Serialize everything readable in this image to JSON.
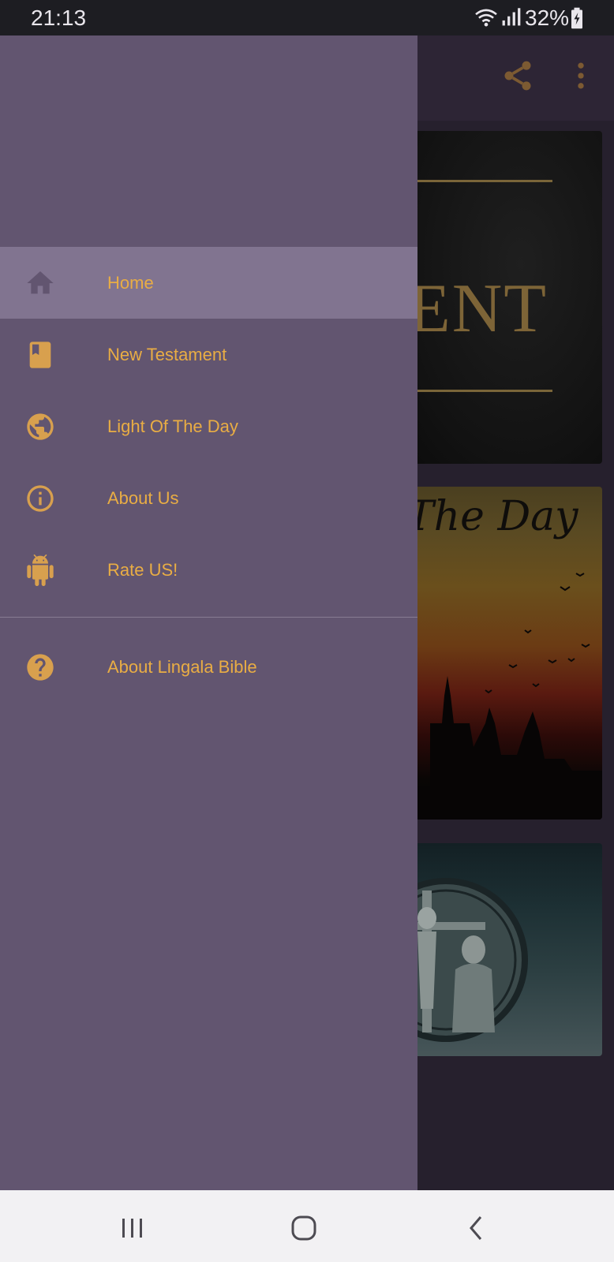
{
  "status_bar": {
    "time": "21:13",
    "battery_percent": "32%",
    "icons": [
      "wifi-icon",
      "signal-icon",
      "battery-charging-icon"
    ]
  },
  "toolbar": {
    "icons": [
      "share-icon",
      "more-vert-icon"
    ],
    "accent_color": "#b27a36"
  },
  "background_cards": {
    "new_testament_text": "ENT",
    "light_of_day_text": "The Day"
  },
  "drawer": {
    "background_color": "#625570",
    "selected_color": "#817490",
    "label_color": "#e9ad44",
    "menu_items": [
      {
        "label": "Home",
        "icon": "home-icon",
        "selected": true
      },
      {
        "label": "New Testament",
        "icon": "book-icon",
        "selected": false
      },
      {
        "label": "Light Of The Day",
        "icon": "globe-icon",
        "selected": false
      },
      {
        "label": "About Us",
        "icon": "info-icon",
        "selected": false
      },
      {
        "label": "Rate US!",
        "icon": "android-icon",
        "selected": false
      }
    ],
    "secondary_items": [
      {
        "label": "About Lingala Bible",
        "icon": "help-icon",
        "selected": false
      }
    ]
  },
  "nav_bar": {
    "buttons": [
      "recent-apps-button",
      "home-button",
      "back-button"
    ]
  }
}
